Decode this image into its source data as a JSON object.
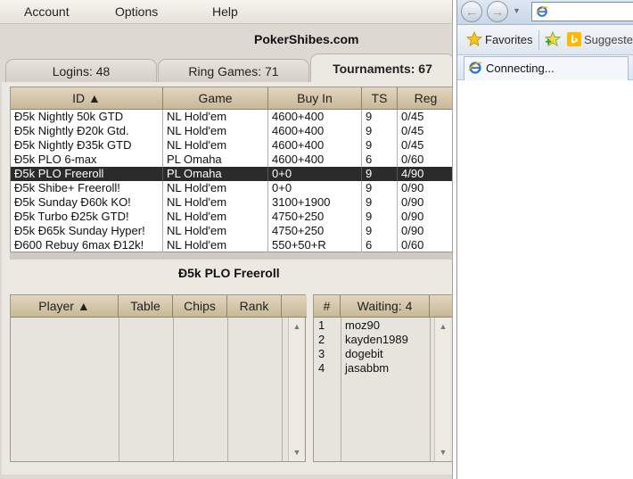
{
  "menu": {
    "account": "Account",
    "options": "Options",
    "help": "Help"
  },
  "site_title": "PokerShibes.com",
  "tabs": {
    "logins": "Logins: 48",
    "ring_games": "Ring Games: 71",
    "tournaments": "Tournaments: 67"
  },
  "tournament_table": {
    "headers": {
      "id": "ID ▲",
      "game": "Game",
      "buy_in": "Buy In",
      "ts": "TS",
      "reg": "Reg"
    },
    "rows": [
      {
        "id": "Đ5k Nightly 50k GTD",
        "game": "NL Hold'em",
        "buy_in": "4600+400",
        "ts": "9",
        "reg": "0/45"
      },
      {
        "id": "Đ5k Nightly Đ20k Gtd.",
        "game": "NL Hold'em",
        "buy_in": "4600+400",
        "ts": "9",
        "reg": "0/45"
      },
      {
        "id": "Đ5k Nightly Đ35k GTD",
        "game": "NL Hold'em",
        "buy_in": "4600+400",
        "ts": "9",
        "reg": "0/45"
      },
      {
        "id": "Đ5k PLO 6-max",
        "game": "PL Omaha",
        "buy_in": "4600+400",
        "ts": "6",
        "reg": "0/60"
      },
      {
        "id": "Đ5k PLO Freeroll",
        "game": "PL Omaha",
        "buy_in": "0+0",
        "ts": "9",
        "reg": "4/90"
      },
      {
        "id": "Đ5k Shibe+ Freeroll!",
        "game": "NL Hold'em",
        "buy_in": "0+0",
        "ts": "9",
        "reg": "0/90"
      },
      {
        "id": "Đ5k Sunday Đ60k KO!",
        "game": "NL Hold'em",
        "buy_in": "3100+1900",
        "ts": "9",
        "reg": "0/90"
      },
      {
        "id": "Đ5k Turbo Đ25k GTD!",
        "game": "NL Hold'em",
        "buy_in": "4750+250",
        "ts": "9",
        "reg": "0/90"
      },
      {
        "id": "Đ5k Đ65k Sunday Hyper!",
        "game": "NL Hold'em",
        "buy_in": "4750+250",
        "ts": "9",
        "reg": "0/90"
      },
      {
        "id": "Đ600 Rebuy 6max Đ12k!",
        "game": "NL Hold'em",
        "buy_in": "550+50+R",
        "ts": "6",
        "reg": "0/60"
      }
    ],
    "selected_index": 4
  },
  "selected_tournament": "Đ5k PLO Freeroll",
  "player_table": {
    "headers": {
      "player": "Player ▲",
      "table": "Table",
      "chips": "Chips",
      "rank": "Rank"
    }
  },
  "waiting_list": {
    "headers": {
      "num": "#",
      "waiting": "Waiting: 4"
    },
    "rows": [
      {
        "num": "1",
        "name": "moz90"
      },
      {
        "num": "2",
        "name": "kayden1989"
      },
      {
        "num": "3",
        "name": "dogebit"
      },
      {
        "num": "4",
        "name": "jasabbm"
      }
    ]
  },
  "browser": {
    "favorites": "Favorites",
    "suggested": "Suggested",
    "tab_title": "Connecting..."
  },
  "colors": {
    "selected_row": "#2b2b2b",
    "header_tan": "#c8b896",
    "panel": "#ece9e3"
  }
}
